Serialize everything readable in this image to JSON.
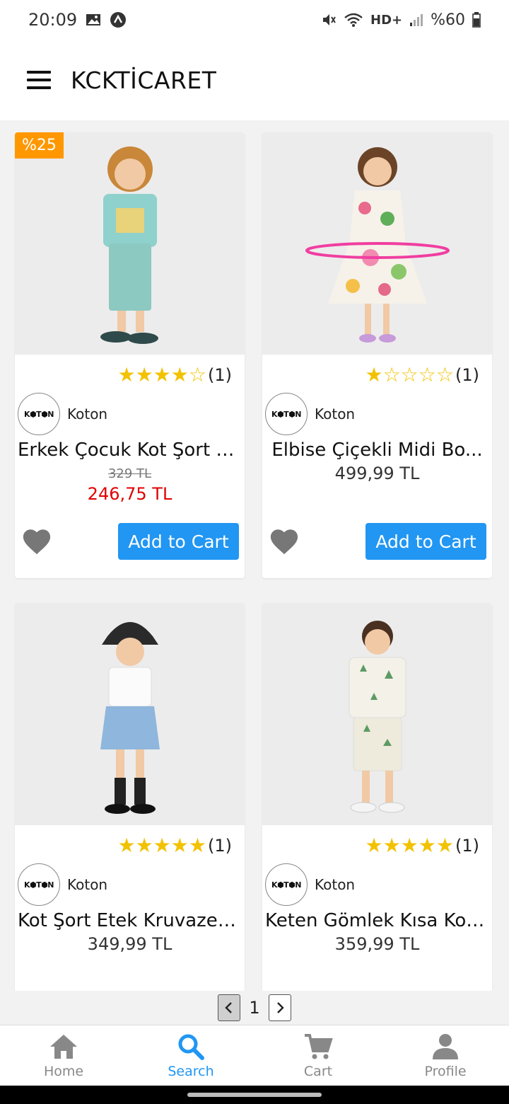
{
  "status_bar": {
    "time": "20:09",
    "network": "HD+",
    "battery": "%60"
  },
  "app_bar": {
    "title": "KCKTİCARET"
  },
  "products": [
    {
      "discount": "%25",
      "rating": 4,
      "rating_count": "(1)",
      "brand_logo": "K⬢T⬢N",
      "brand": "Koton",
      "name": "Erkek Çocuk Kot Şort Cep...",
      "old_price": "329 TL",
      "price": "246,75 TL",
      "add_label": "Add to Cart"
    },
    {
      "rating": 1,
      "rating_count": "(1)",
      "brand_logo": "K⬢T⬢N",
      "brand": "Koton",
      "name": "Elbise Çiçekli Midi Bo...",
      "price": "499,99 TL",
      "add_label": "Add to Cart"
    },
    {
      "rating": 5,
      "rating_count": "(1)",
      "brand_logo": "K⬢T⬢N",
      "brand": "Koton",
      "name": "Kot Şort Etek Kruvaze Cepli",
      "price": "349,99 TL"
    },
    {
      "rating": 5,
      "rating_count": "(1)",
      "brand_logo": "K⬢T⬢N",
      "brand": "Koton",
      "name": "Keten Gömlek Kısa Koll...",
      "price": "359,99 TL"
    }
  ],
  "pagination": {
    "current_page": "1"
  },
  "bottom_nav": {
    "items": [
      {
        "label": "Home",
        "icon": "home-icon"
      },
      {
        "label": "Search",
        "icon": "search-icon",
        "active": true
      },
      {
        "label": "Cart",
        "icon": "cart-icon"
      },
      {
        "label": "Profile",
        "icon": "profile-icon"
      }
    ]
  },
  "colors": {
    "accent": "#2196f3",
    "sale": "#e00000",
    "badge": "#ff9800",
    "star": "#f2c200"
  }
}
